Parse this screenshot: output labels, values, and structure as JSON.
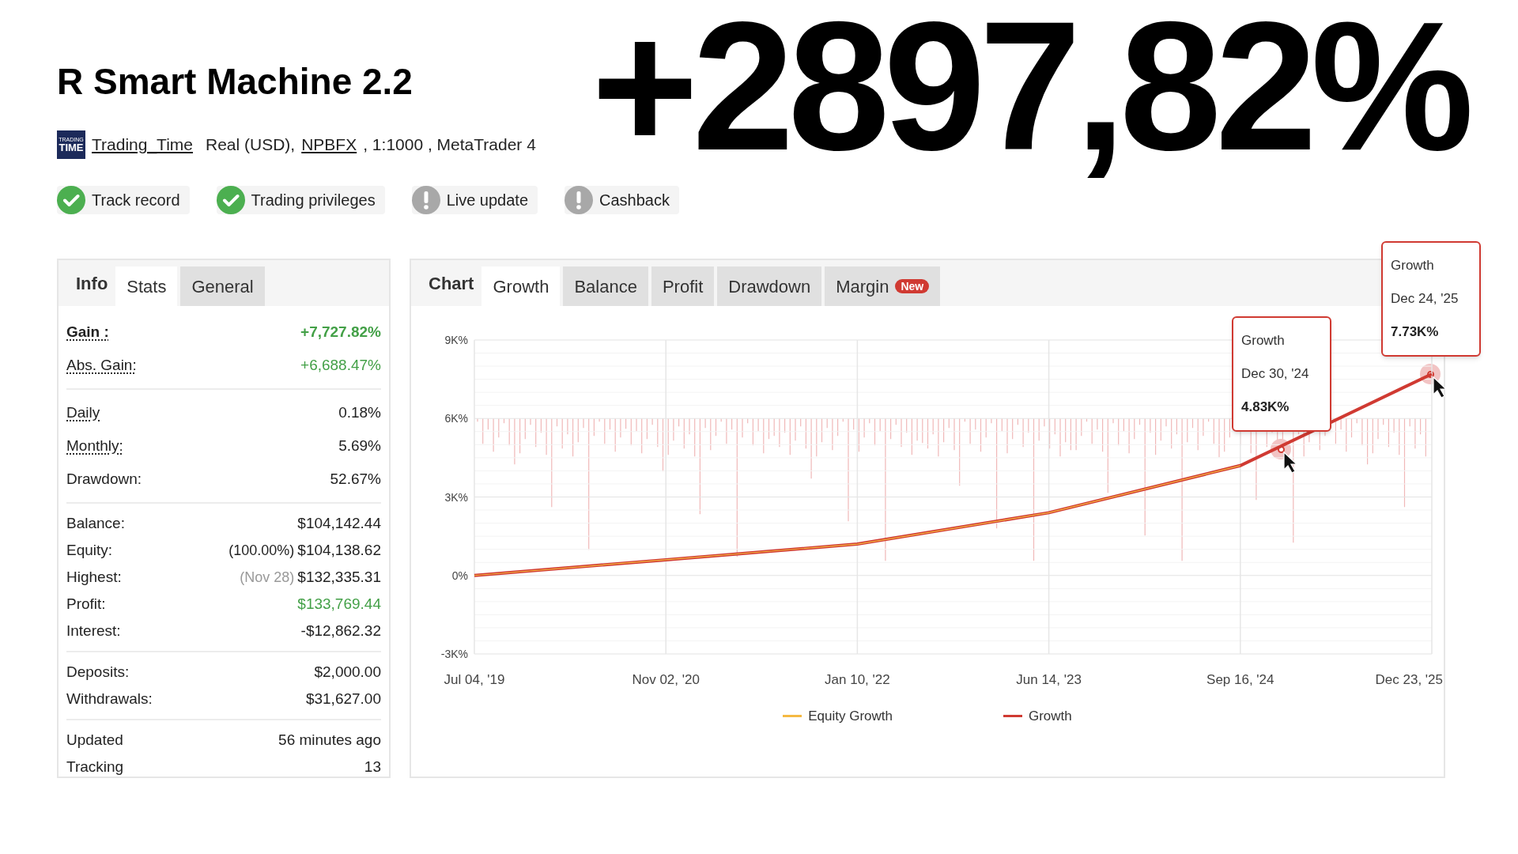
{
  "headline": "+2897,82%",
  "title": "R Smart Machine 2.2",
  "account": {
    "logo_text": [
      "TRADING",
      "TIME"
    ],
    "user": "Trading_Time",
    "type": "Real (USD),",
    "broker": "NPBFX",
    "details": ", 1:1000 , MetaTrader 4"
  },
  "badges": [
    {
      "label": "Track record",
      "verified": true
    },
    {
      "label": "Trading privileges",
      "verified": true
    },
    {
      "label": "Live update",
      "verified": false
    },
    {
      "label": "Cashback",
      "verified": false
    }
  ],
  "stats_panel": {
    "heading": "Info",
    "tabs": [
      {
        "label": "Stats",
        "selected": true
      },
      {
        "label": "General",
        "selected": false
      }
    ],
    "groups": [
      [
        {
          "label": "Gain :",
          "value": "+7,727.82%",
          "bold": true,
          "dotted": true,
          "color": "#43a047"
        },
        {
          "label": "Abs. Gain:",
          "value": "+6,688.47%",
          "bold": false,
          "dotted": true,
          "color": "#43a047"
        }
      ],
      [
        {
          "label": "Daily",
          "value": "0.18%",
          "bold": false,
          "dotted": true
        },
        {
          "label": "Monthly:",
          "value": "5.69%",
          "bold": false,
          "dotted": true
        },
        {
          "label": "Drawdown:",
          "value": "52.67%",
          "bold": false,
          "dotted": false
        }
      ],
      [
        {
          "label": "Balance:",
          "value": "$104,142.44",
          "bold": false,
          "dotted": false
        },
        {
          "label": "Equity:",
          "note": "(100.00%)",
          "value": "$104,138.62",
          "bold": false,
          "dotted": false
        },
        {
          "label": "Highest:",
          "note": "(Nov 28)",
          "muted_note": true,
          "value": "$132,335.31",
          "bold": false,
          "dotted": false
        },
        {
          "label": "Profit:",
          "value": "$133,769.44",
          "bold": false,
          "dotted": false,
          "color": "#43a047"
        },
        {
          "label": "Interest:",
          "value": "-$12,862.32",
          "bold": false,
          "dotted": false
        }
      ],
      [
        {
          "label": "Deposits:",
          "value": "$2,000.00",
          "bold": false,
          "dotted": false
        },
        {
          "label": "Withdrawals:",
          "value": "$31,627.00",
          "bold": false,
          "dotted": false
        }
      ],
      [
        {
          "label": "Updated",
          "value": "56 minutes ago",
          "bold": false,
          "dotted": false
        },
        {
          "label": "Tracking",
          "value": "13",
          "bold": false,
          "dotted": false
        }
      ]
    ]
  },
  "chart_panel": {
    "heading": "Chart",
    "tabs": [
      {
        "label": "Growth",
        "selected": true
      },
      {
        "label": "Balance",
        "selected": false
      },
      {
        "label": "Profit",
        "selected": false
      },
      {
        "label": "Drawdown",
        "selected": false
      },
      {
        "label": "Margin",
        "selected": false,
        "badge": "New"
      }
    ],
    "chart_data": {
      "type": "line",
      "categories": [
        "Jul 04, '19",
        "Nov 02, '20",
        "Jan 10, '22",
        "Jun 14, '23",
        "Sep 16, '24",
        "Dec 23, '25"
      ],
      "series": [
        {
          "name": "Equity Growth",
          "color": "#f5b942",
          "values": [
            0,
            600,
            1200,
            2400,
            4200,
            null
          ]
        },
        {
          "name": "Growth",
          "color": "#d03a32",
          "values": [
            0,
            600,
            1200,
            2400,
            4200,
            7700
          ]
        }
      ],
      "grid": true,
      "legend": true,
      "ylim": [
        -3000,
        9000
      ],
      "yticks": [
        {
          "value": -3000,
          "label": "-3K%"
        },
        {
          "value": 0,
          "label": "0%"
        },
        {
          "value": 3000,
          "label": "3K%"
        },
        {
          "value": 6000,
          "label": "6K%"
        },
        {
          "value": 9000,
          "label": "9K%"
        }
      ]
    },
    "tooltips": [
      {
        "series": "Growth",
        "date": "Dec 30, '24",
        "value": "4.83K%"
      },
      {
        "series": "Growth",
        "date": "Dec 24, '25",
        "value": "7.73K%"
      }
    ]
  }
}
